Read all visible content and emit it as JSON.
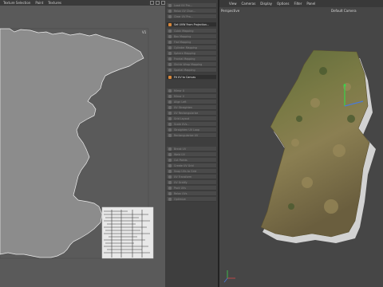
{
  "uv_editor": {
    "menu": [
      "Texture Selection",
      "Paint",
      "Textures"
    ],
    "tile_marker": "V1"
  },
  "commands": {
    "top_items": [
      {
        "label": "Load UV Pro...",
        "highlight": false
      },
      {
        "label": "Relax UV Chan...",
        "highlight": false
      },
      {
        "label": "Clear UV Pro...",
        "highlight": false
      }
    ],
    "project_item": {
      "label": "Set UVW From Projection...",
      "highlight": true
    },
    "proj_items": [
      {
        "label": "Cubic Mapping",
        "highlight": false
      },
      {
        "label": "Box Mapping",
        "highlight": false
      },
      {
        "label": "Flat Mapping",
        "highlight": false
      },
      {
        "label": "Cylinder Mapping",
        "highlight": false
      },
      {
        "label": "Sphere Mapping",
        "highlight": false
      },
      {
        "label": "Frontal Mapping",
        "highlight": false
      },
      {
        "label": "Shrink Wrap Mapping",
        "highlight": false
      },
      {
        "label": "Spatial Mapping",
        "highlight": false
      }
    ],
    "fit_item": {
      "label": "Fit UV to Canvas",
      "highlight": true
    },
    "lower_items": [
      {
        "label": "Mirror U",
        "highlight": false
      },
      {
        "label": "Mirror V",
        "highlight": false
      },
      {
        "label": "Align Left",
        "highlight": false
      },
      {
        "label": "UV Straighten",
        "highlight": false
      },
      {
        "label": "UV Rectangularize",
        "highlight": false
      },
      {
        "label": "Grid Layout",
        "highlight": false
      },
      {
        "label": "Scale UVs...",
        "highlight": false
      },
      {
        "label": "Straighten UV Loop",
        "highlight": false
      },
      {
        "label": "Rectangularize UV",
        "highlight": false
      }
    ],
    "bottom_items": [
      {
        "label": "Break UV",
        "highlight": false
      },
      {
        "label": "Weld UV",
        "highlight": false
      },
      {
        "label": "Cut Points",
        "highlight": false
      },
      {
        "label": "Create UV Grid",
        "highlight": false
      },
      {
        "label": "Snap UVs to Grid",
        "highlight": false
      },
      {
        "label": "UV Transform",
        "highlight": false
      },
      {
        "label": "UV Gridify",
        "highlight": false
      },
      {
        "label": "Pack UVs",
        "highlight": false
      },
      {
        "label": "Relax UVs",
        "highlight": false
      },
      {
        "label": "Optimize",
        "highlight": false
      }
    ]
  },
  "viewport": {
    "menu": [
      "View",
      "Cameras",
      "Display",
      "Options",
      "Filter",
      "Panel"
    ],
    "mode": "Perspective",
    "camera": "Default Camera"
  },
  "colors": {
    "uv_background": "#5a5a5a",
    "uv_shape": "#8c8c8c",
    "highlight_icon": "#d9883a",
    "viewport_bg": "#464646"
  }
}
